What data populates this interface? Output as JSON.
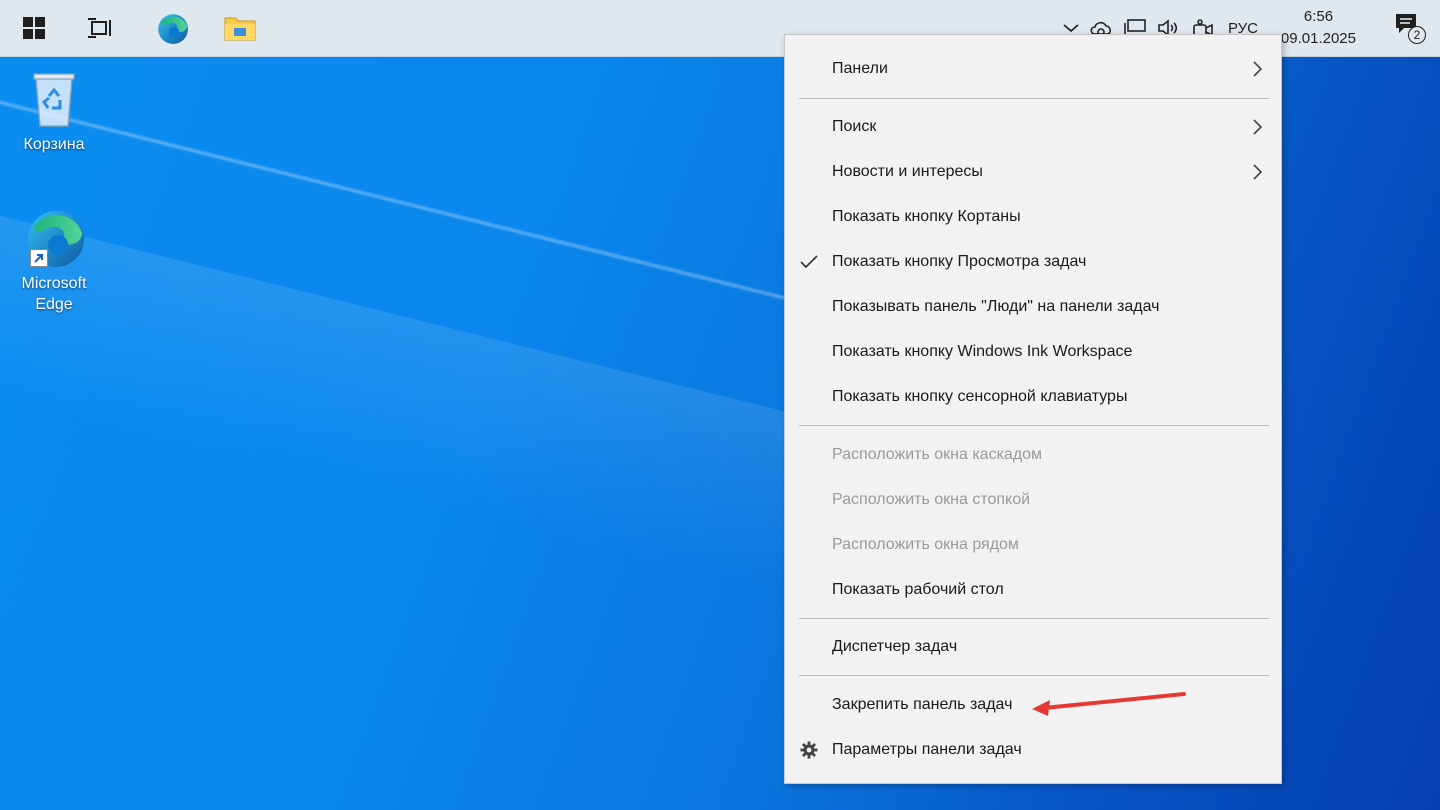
{
  "desktop": {
    "icons": [
      {
        "name": "Корзина"
      },
      {
        "name_line1": "Microsoft",
        "name_line2": "Edge"
      }
    ]
  },
  "taskbar": {
    "pinned": [
      "windows-start-icon",
      "task-view-icon",
      "edge-icon",
      "file-explorer-icon"
    ],
    "tray": {
      "language": "РУС",
      "time": "6:56",
      "date": "09.01.2025",
      "notifications_count": "2"
    }
  },
  "context_menu": {
    "items": [
      {
        "label": "Панели",
        "submenu": true
      },
      {
        "label": "Поиск",
        "submenu": true
      },
      {
        "label": "Новости и интересы",
        "submenu": true
      },
      {
        "label": "Показать кнопку Кортаны"
      },
      {
        "label": "Показать кнопку Просмотра задач",
        "checked": true
      },
      {
        "label": "Показывать панель \"Люди\" на панели задач"
      },
      {
        "label": "Показать кнопку Windows Ink Workspace"
      },
      {
        "label": "Показать кнопку сенсорной клавиатуры"
      },
      {
        "label": "Расположить окна каскадом",
        "disabled": true
      },
      {
        "label": "Расположить окна стопкой",
        "disabled": true
      },
      {
        "label": "Расположить окна рядом",
        "disabled": true
      },
      {
        "label": "Показать рабочий стол"
      },
      {
        "label": "Диспетчер задач"
      },
      {
        "label": "Закрепить панель задач"
      },
      {
        "label": "Параметры панели задач",
        "icon": "gear-icon"
      }
    ]
  },
  "annotation": {
    "arrow_color": "#e53935"
  }
}
